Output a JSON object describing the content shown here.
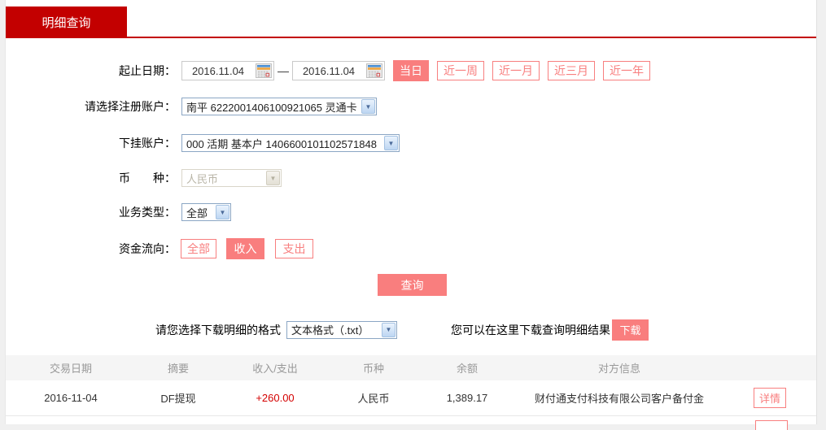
{
  "colors": {
    "accent_red": "#c30000",
    "pink_border": "#f87f7f",
    "pink_fill": "#f97e7e",
    "amount_red": "#d40000",
    "table_header_bg": "#f5f5f5"
  },
  "icons": {
    "dropdown_arrow": "▼",
    "calendar": "calendar-icon"
  },
  "tab": {
    "label": "明细查询"
  },
  "form": {
    "date_range": {
      "label": "起止日期：",
      "start": "2016.11.04",
      "end": "2016.11.04",
      "separator": "—",
      "quick_buttons": [
        {
          "label": "当日",
          "active": true
        },
        {
          "label": "近一周",
          "active": false
        },
        {
          "label": "近一月",
          "active": false
        },
        {
          "label": "近三月",
          "active": false
        },
        {
          "label": "近一年",
          "active": false
        }
      ]
    },
    "register_account": {
      "label": "请选择注册账户：",
      "value": "南平 6222001406100921065 灵通卡"
    },
    "sub_account": {
      "label": "下挂账户：",
      "value": "000 活期 基本户 1406600101102571848"
    },
    "currency": {
      "label": "币　　种：",
      "value": "人民币",
      "disabled": true
    },
    "business_type": {
      "label": "业务类型：",
      "value": "全部"
    },
    "fund_direction": {
      "label": "资金流向：",
      "options": [
        {
          "label": "全部",
          "active": false
        },
        {
          "label": "收入",
          "active": true
        },
        {
          "label": "支出",
          "active": false
        }
      ]
    },
    "query_button": "查询"
  },
  "download": {
    "format_label": "请您选择下载明细的格式",
    "format_value": "文本格式（.txt）",
    "hint": "您可以在这里下载查询明细结果",
    "button_label": "下载"
  },
  "table": {
    "headers": [
      "交易日期",
      "摘要",
      "收入/支出",
      "币种",
      "余额",
      "对方信息"
    ],
    "rows": [
      {
        "date": "2016-11-04",
        "summary": "DF提现",
        "amount": "+260.00",
        "currency": "人民币",
        "balance": "1,389.17",
        "counterparty": "财付通支付科技有限公司客户备付金",
        "detail_label": "详情"
      }
    ]
  }
}
